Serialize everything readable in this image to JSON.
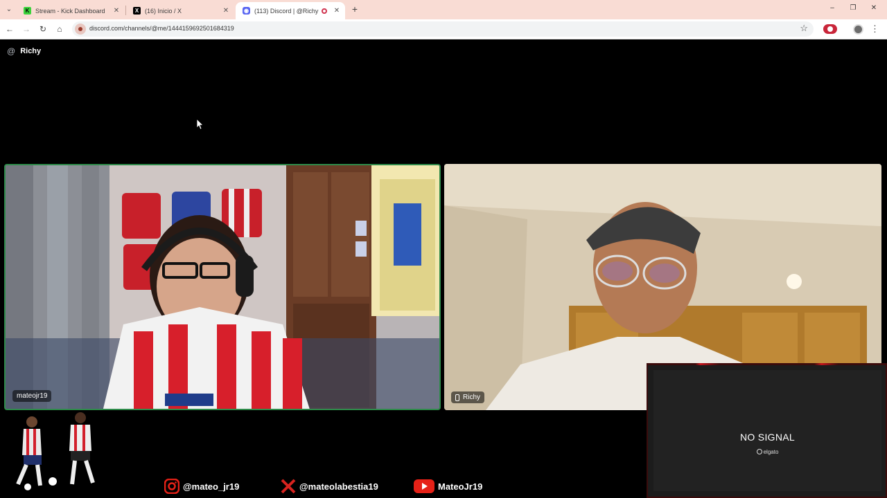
{
  "browser": {
    "tabs": [
      {
        "title": "Stream - Kick Dashboard",
        "active": false
      },
      {
        "title": "(16) Inicio / X",
        "active": false
      },
      {
        "title": "(113) Discord | @Richy",
        "active": true
      }
    ],
    "url": "discord.com/channels/@me/1444159692501684319"
  },
  "call": {
    "dm_name": "Richy",
    "participants": [
      {
        "name": "mateojr19",
        "speaking": true
      },
      {
        "name": "Richy",
        "device": "mobile"
      }
    ]
  },
  "overlay": {
    "capture_status": "NO SIGNAL",
    "capture_brand": "elgato",
    "socials": [
      {
        "platform": "instagram",
        "handle": "@mateo_jr19"
      },
      {
        "platform": "x",
        "handle": "@mateolabestia19"
      },
      {
        "platform": "youtube",
        "handle": "MateoJr19"
      }
    ]
  },
  "colors": {
    "tab_bar": "#f9dcd4",
    "speaking_border": "#2e8b4a",
    "youtube_red": "#e62117",
    "x_red": "#d8231f"
  }
}
